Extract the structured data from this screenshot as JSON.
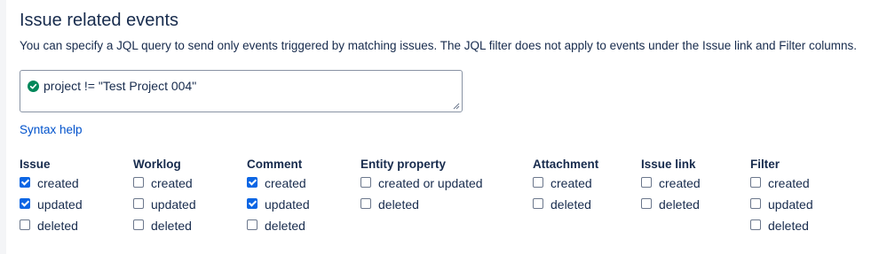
{
  "section": {
    "title": "Issue related events",
    "description": "You can specify a JQL query to send only events triggered by matching issues. The JQL filter does not apply to events under the Issue link and Filter columns."
  },
  "jql": {
    "query": "project != \"Test Project 004\"",
    "status_icon": "check-circle-icon",
    "status_color": "#00875a"
  },
  "syntax_help": "Syntax help",
  "columns": [
    {
      "heading": "Issue",
      "options": [
        {
          "label": "created",
          "checked": true
        },
        {
          "label": "updated",
          "checked": true
        },
        {
          "label": "deleted",
          "checked": false
        }
      ]
    },
    {
      "heading": "Worklog",
      "options": [
        {
          "label": "created",
          "checked": false
        },
        {
          "label": "updated",
          "checked": false
        },
        {
          "label": "deleted",
          "checked": false
        }
      ]
    },
    {
      "heading": "Comment",
      "options": [
        {
          "label": "created",
          "checked": true
        },
        {
          "label": "updated",
          "checked": true
        },
        {
          "label": "deleted",
          "checked": false
        }
      ]
    },
    {
      "heading": "Entity property",
      "options": [
        {
          "label": "created or updated",
          "checked": false
        },
        {
          "label": "deleted",
          "checked": false
        }
      ]
    },
    {
      "heading": "Attachment",
      "options": [
        {
          "label": "created",
          "checked": false
        },
        {
          "label": "deleted",
          "checked": false
        }
      ]
    },
    {
      "heading": "Issue link",
      "options": [
        {
          "label": "created",
          "checked": false
        },
        {
          "label": "deleted",
          "checked": false
        }
      ]
    },
    {
      "heading": "Filter",
      "options": [
        {
          "label": "created",
          "checked": false
        },
        {
          "label": "updated",
          "checked": false
        },
        {
          "label": "deleted",
          "checked": false
        }
      ]
    }
  ],
  "colors": {
    "link": "#0052cc",
    "checkbox_checked": "#0c66e4"
  }
}
